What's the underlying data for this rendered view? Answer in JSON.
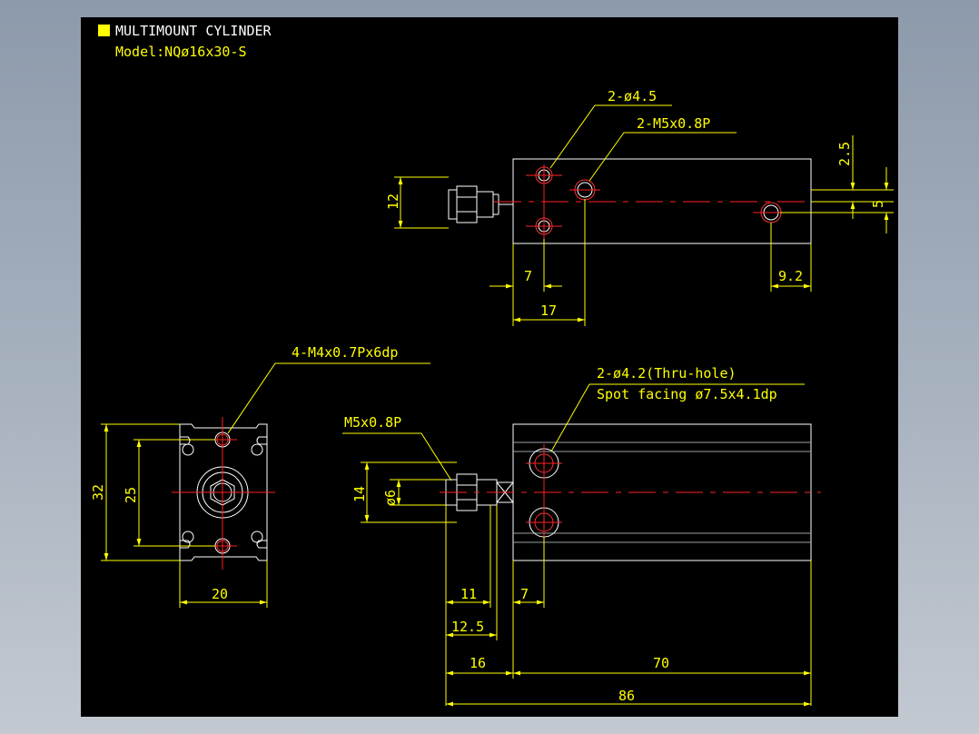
{
  "title": {
    "name": "MULTIMOUNT CYLINDER",
    "model": "Model:NQø16x30-S",
    "marker_color": "#ffff00"
  },
  "colors": {
    "background": "#000000",
    "outline": "#ffffff",
    "dimension": "#ffff00",
    "centerline": "#ff2020"
  },
  "top_view": {
    "callout_holes": "2-ø4.5",
    "callout_threads": "2-M5x0.8P",
    "dims": {
      "d12": "12",
      "d2_5": "2.5",
      "d5": "5",
      "d7": "7",
      "d17": "17",
      "d9_2": "9.2"
    }
  },
  "end_view": {
    "callout": "4-M4x0.7Px6dp",
    "dims": {
      "d32": "32",
      "d25": "25",
      "d20": "20"
    }
  },
  "side_view": {
    "callout_thru_1": "2-ø4.2(Thru-hole)",
    "callout_thru_2": "Spot facing ø7.5x4.1dp",
    "callout_thread": "M5x0.8P",
    "dims": {
      "d14": "14",
      "d6": "ø6",
      "d11": "11",
      "d12_5": "12.5",
      "d7": "7",
      "d16": "16",
      "d70": "70",
      "d86": "86"
    }
  }
}
